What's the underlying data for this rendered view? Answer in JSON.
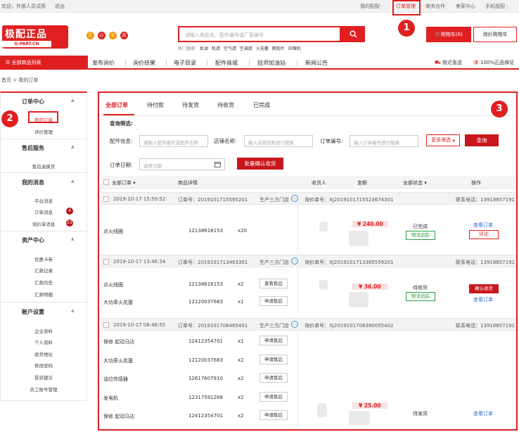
{
  "topbar": {
    "welcome": "欢迎，外部人员试用",
    "logout": "退出",
    "my_parts": "我的配配 ·",
    "order_mgmt": "订单管理",
    "business": "商务合作",
    "seller_center": "卖家中心",
    "mobile": "手机极配 ·"
  },
  "logo": {
    "line1": "极配正品",
    "line2": "G-PART.CN"
  },
  "badges": [
    "正",
    "心",
    "正",
    "品"
  ],
  "search": {
    "placeholder": "请输入商品名、配件编号或厂家编号",
    "hot_label": "热门搜索:",
    "hot": [
      "机油",
      "机滤",
      "空气滤",
      "空调滤",
      "火花塞",
      "雨刮片",
      "压缩机"
    ]
  },
  "cart": {
    "label": "购物车(6)",
    "inquiry": "询价购物车"
  },
  "nav": {
    "all_categories": "全部商品列表",
    "items": [
      "发布询价",
      "询价结果",
      "电子目录",
      "配件商城",
      "技师加油站",
      "新闻公告"
    ],
    "fast_delivery": "就近急送",
    "guarantee": "100%正品保证"
  },
  "breadcrumb": "首页 > 我的订单",
  "annotations": [
    "1",
    "2",
    "3"
  ],
  "sidebar": {
    "sections": [
      {
        "title": "订单中心",
        "items": [
          "我的订单",
          "评价管理"
        ]
      },
      {
        "title": "售后服务",
        "items": [
          "售后退换货"
        ]
      },
      {
        "title": "我的消息",
        "items": [
          "平台消息",
          "订单消息",
          "询价单消息"
        ],
        "badges": [
          "",
          "4",
          "23"
        ]
      },
      {
        "title": "资产中心",
        "items": [
          "优惠卡券",
          "汇款记录",
          "汇款历史",
          "汇款明细"
        ]
      },
      {
        "title": "账户设置",
        "items": [
          "企业资料",
          "个人资料",
          "收货地址",
          "修改密码",
          "投诉建议",
          "员工账号管理"
        ]
      }
    ]
  },
  "tabs": [
    "全部订单",
    "待付款",
    "待发货",
    "待收货",
    "已完成"
  ],
  "filter": {
    "title": "查询筛选:",
    "part_label": "配件信息:",
    "part_placeholder": "请输入配件编号或配件名称",
    "store_label": "店铺名称:",
    "store_placeholder": "输入店铺名称进行搜索",
    "order_label": "订单编号:",
    "order_placeholder": "输入订单编号进行搜索",
    "more": "更多筛选 ▴",
    "search_btn": "查询",
    "date_label": "订单日期:",
    "date_placeholder": "选择日期",
    "batch_btn": "批量确认收货"
  },
  "table_head": {
    "all_orders": "全部订单 ▾",
    "detail": "商品详情",
    "receiver": "收货人",
    "amount": "金额",
    "status": "全部状态 ▾",
    "action": "操作"
  },
  "orders": [
    {
      "date": "2019-10-17 15:59:52",
      "order_no": "订单号：2019101715595201",
      "store": "生产三方门店",
      "inquiry_no": "询价单号：XJ2019101715523674301",
      "contact": "联系电话：13918857191",
      "items": [
        {
          "name": "点火线圈",
          "code": "12138616153",
          "qty": "x20",
          "btn": ""
        }
      ],
      "price": "¥ 240.00",
      "status": "已完成",
      "status_btn": "物流追踪",
      "links": [
        "查看订单"
      ],
      "action_btn": "评论"
    },
    {
      "date": "2019-10-17 13:46:34",
      "order_no": "订单号：2019101713463301",
      "store": "生产三方门店",
      "inquiry_no": "询价单号：XJ2019101713385559201",
      "contact": "联系电话：13918857191",
      "items": [
        {
          "name": "点火线圈",
          "code": "12138616153",
          "qty": "x2",
          "btn": "查看售后"
        },
        {
          "name": "大功率火花塞",
          "code": "12120037663",
          "qty": "x1",
          "btn": "申请售后"
        }
      ],
      "price": "¥ 36.00",
      "status": "待收货",
      "status_btn": "物流追踪",
      "action_btn": "确认收货",
      "links": [
        "查看订单"
      ]
    },
    {
      "date": "2019-10-17 08:46:55",
      "order_no": "订单号：2019101708465401",
      "store": "生产三方门店",
      "inquiry_no": "询价单号：XJ2019101708380055402",
      "contact": "联系电话：13918857191",
      "items": [
        {
          "name": "保修 起动马达",
          "code": "12412354701",
          "qty": "x1",
          "btn": "申请售后"
        },
        {
          "name": "大功率火花塞",
          "code": "12120037663",
          "qty": "x2",
          "btn": "申请售后"
        },
        {
          "name": "油位传感器",
          "code": "12617607910",
          "qty": "x2",
          "btn": "申请售后"
        },
        {
          "name": "发电机",
          "code": "12317591268",
          "qty": "x2",
          "btn": "申请售后"
        },
        {
          "name": "保修 起动马达",
          "code": "12412354701",
          "qty": "x2",
          "btn": "申请售后"
        }
      ],
      "price": "¥ 25.00",
      "status": "待发货",
      "links": [
        "查看订单"
      ]
    }
  ],
  "colors": {
    "brand_red": "#e02020",
    "dark_red": "#c8161d",
    "link_blue": "#2f6fd6",
    "green": "#2e9e3e"
  }
}
